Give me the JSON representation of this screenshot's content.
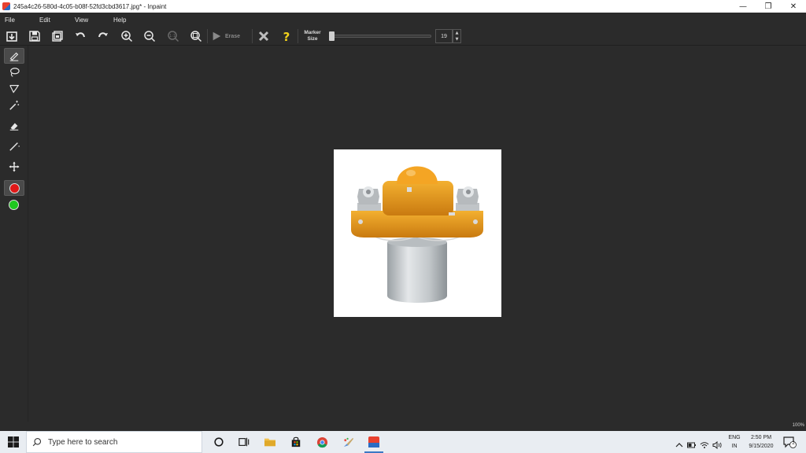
{
  "window": {
    "title": "245a4c26-580d-4c05-b08f-52fd3cbd3617.jpg* - Inpaint",
    "minimize_glyph": "—",
    "restore_glyph": "❐",
    "close_glyph": "✕"
  },
  "menu": {
    "items": [
      {
        "label": "File"
      },
      {
        "label": "Edit"
      },
      {
        "label": "View"
      },
      {
        "label": "Help"
      }
    ]
  },
  "toolbar": {
    "erase_label": "Erase",
    "marker_size_label_line1": "Marker",
    "marker_size_label_line2": "Size",
    "marker_size_value": "19",
    "marker_size_fraction": 0.02,
    "spin_up": "▲",
    "spin_down": "▼",
    "icons": [
      "open-icon",
      "save-icon",
      "save-as-icon",
      "undo-icon",
      "redo-icon",
      "zoom-in-icon",
      "zoom-out-icon",
      "zoom-actual-icon",
      "zoom-fit-icon",
      "play-icon",
      "cancel-icon",
      "help-icon"
    ]
  },
  "tools": {
    "items": [
      "marker-icon",
      "lasso-icon",
      "polygon-lasso-icon",
      "magic-wand-icon",
      "eraser-icon",
      "line-icon",
      "move-icon"
    ],
    "colors": {
      "red": "#e01818",
      "green": "#1ec81e"
    }
  },
  "canvas": {
    "image_subject": "orange and silver solenoid contactor"
  },
  "status": {
    "zoom": "100%"
  },
  "taskbar": {
    "search_placeholder": "Type here to search",
    "lang_line1": "ENG",
    "lang_line2": "IN",
    "time": "2:50 PM",
    "date": "9/15/2020",
    "notification_count": "2"
  },
  "colors": {
    "app_bg": "#2b2b2b",
    "taskbar_bg": "#e9edf2",
    "accent": "#3b78c4",
    "help_yellow": "#f2d21b"
  }
}
